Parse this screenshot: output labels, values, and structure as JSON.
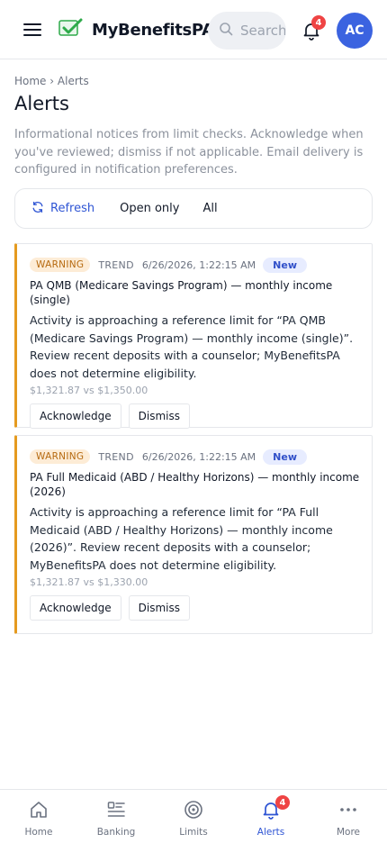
{
  "app": {
    "name": "MyBenefitsPA"
  },
  "header": {
    "search_placeholder": "Search",
    "notification_count": "4",
    "avatar_initials": "AC"
  },
  "breadcrumb": {
    "home": "Home",
    "separator": "›",
    "current": "Alerts"
  },
  "page": {
    "title": "Alerts",
    "description": "Informational notices from limit checks. Acknowledge when you've reviewed; dismiss if not applicable. Email delivery is configured in notification preferences."
  },
  "filters": {
    "refresh_label": "Refresh",
    "open_only_label": "Open only",
    "all_label": "All"
  },
  "alerts": [
    {
      "severity": "WARNING",
      "type": "TREND",
      "timestamp": "6/26/2026, 1:22:15 AM",
      "status": "New",
      "title": "PA QMB (Medicare Savings Program) — monthly income (single)",
      "body": "Activity is approaching a reference limit for “PA QMB (Medicare Savings Program) — monthly income (single)”. Review recent deposits with a counselor; MyBenefitsPA does not determine eligibility.",
      "comparison": "$1,321.87 vs $1,350.00",
      "acknowledge_label": "Acknowledge",
      "dismiss_label": "Dismiss"
    },
    {
      "severity": "WARNING",
      "type": "TREND",
      "timestamp": "6/26/2026, 1:22:15 AM",
      "status": "New",
      "title": "PA Full Medicaid (ABD / Healthy Horizons) — monthly income (2026)",
      "body": "Activity is approaching a reference limit for “PA Full Medicaid (ABD / Healthy Horizons) — monthly income (2026)”. Review recent deposits with a counselor; MyBenefitsPA does not determine eligibility.",
      "comparison": "$1,321.87 vs $1,330.00",
      "acknowledge_label": "Acknowledge",
      "dismiss_label": "Dismiss"
    }
  ],
  "bottom_nav": {
    "items": [
      {
        "label": "Home",
        "icon": "home-icon"
      },
      {
        "label": "Banking",
        "icon": "list-icon"
      },
      {
        "label": "Limits",
        "icon": "target-icon"
      },
      {
        "label": "Alerts",
        "icon": "bell-icon",
        "badge": "4",
        "active": true
      },
      {
        "label": "More",
        "icon": "more-dots-icon"
      }
    ]
  },
  "colors": {
    "accent": "#2f55d4",
    "avatar": "#3b63e0",
    "warning_border": "#e59a1f",
    "badge": "#ef4444",
    "brand_check": "#2eaa4a"
  }
}
